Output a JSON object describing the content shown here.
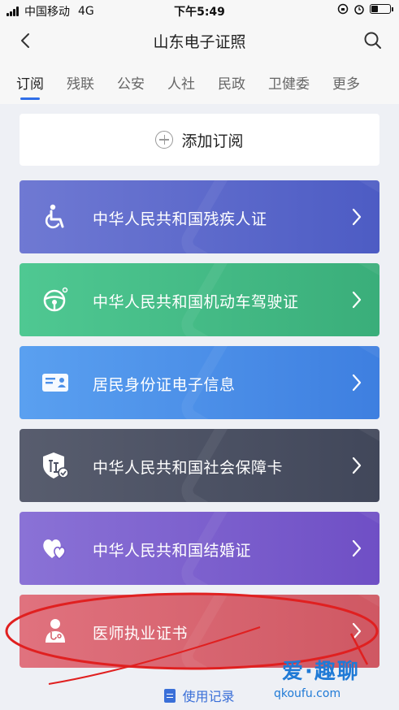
{
  "status_bar": {
    "carrier": "中国移动",
    "network": "4G",
    "time": "下午5:49"
  },
  "header": {
    "title": "山东电子证照"
  },
  "tabs": [
    {
      "label": "订阅",
      "active": true
    },
    {
      "label": "残联",
      "active": false
    },
    {
      "label": "公安",
      "active": false
    },
    {
      "label": "人社",
      "active": false
    },
    {
      "label": "民政",
      "active": false
    },
    {
      "label": "卫健委",
      "active": false
    },
    {
      "label": "更多",
      "active": false
    }
  ],
  "add_subscription": {
    "label": "添加订阅",
    "icon": "plus-circle-icon"
  },
  "certificates": [
    {
      "label": "中华人民共和国残疾人证",
      "icon": "wheelchair-icon",
      "color": "#5d6acb"
    },
    {
      "label": "中华人民共和国机动车驾驶证",
      "icon": "steering-wheel-icon",
      "color": "#44bb86"
    },
    {
      "label": "居民身份证电子信息",
      "icon": "id-card-icon",
      "color": "#4c90e8"
    },
    {
      "label": "中华人民共和国社会保障卡",
      "icon": "social-security-shield-icon",
      "color": "#4d5264"
    },
    {
      "label": "中华人民共和国结婚证",
      "icon": "hearts-icon",
      "color": "#7c60cd"
    },
    {
      "label": "医师执业证书",
      "icon": "doctor-icon",
      "color": "#d7646f"
    }
  ],
  "records_link": {
    "label": "使用记录",
    "icon": "document-icon"
  },
  "watermark": {
    "main": "爱·趣聊",
    "sub": "qkoufu.com"
  },
  "colors": {
    "accent": "#2f6ee8",
    "annotation": "#e02020"
  }
}
